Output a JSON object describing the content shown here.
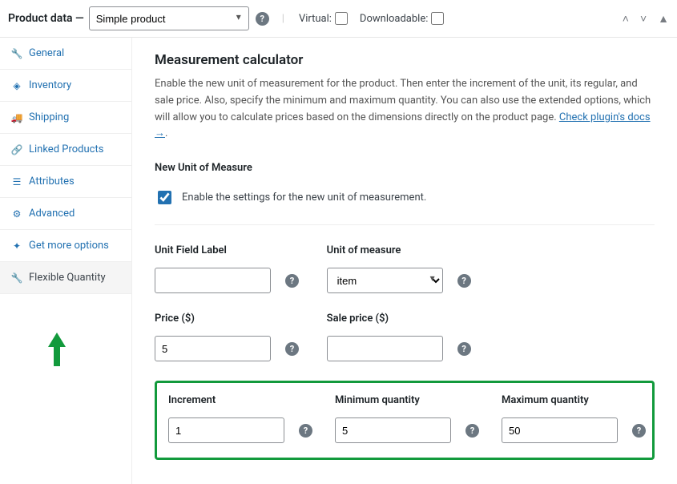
{
  "header": {
    "title": "Product data —",
    "product_type": "Simple product",
    "virtual_label": "Virtual:",
    "downloadable_label": "Downloadable:"
  },
  "sidebar": {
    "items": [
      {
        "label": "General",
        "icon": "🔧"
      },
      {
        "label": "Inventory",
        "icon": "◈"
      },
      {
        "label": "Shipping",
        "icon": "🚚"
      },
      {
        "label": "Linked Products",
        "icon": "🔗"
      },
      {
        "label": "Attributes",
        "icon": "☰"
      },
      {
        "label": "Advanced",
        "icon": "⚙"
      },
      {
        "label": "Get more options",
        "icon": "✦"
      },
      {
        "label": "Flexible Quantity",
        "icon": "🔧"
      }
    ]
  },
  "main": {
    "heading": "Measurement calculator",
    "description": "Enable the new unit of measurement for the product. Then enter the increment of the unit, its regular, and sale price. Also, specify the minimum and maximum quantity. You can also use the extended options, which will allow you to calculate prices based on the dimensions directly on the product page. ",
    "docs_link": "Check plugin's docs →",
    "new_unit_section": "New Unit of Measure",
    "enable_label": "Enable the settings for the new unit of measurement.",
    "enable_checked": true,
    "fields": {
      "unit_field_label": {
        "label": "Unit Field Label",
        "value": ""
      },
      "unit_of_measure": {
        "label": "Unit of measure",
        "value": "item"
      },
      "price": {
        "label": "Price ($)",
        "value": "5"
      },
      "sale_price": {
        "label": "Sale price ($)",
        "value": ""
      },
      "increment": {
        "label": "Increment",
        "value": "1"
      },
      "min_qty": {
        "label": "Minimum quantity",
        "value": "5"
      },
      "max_qty": {
        "label": "Maximum quantity",
        "value": "50"
      }
    }
  }
}
